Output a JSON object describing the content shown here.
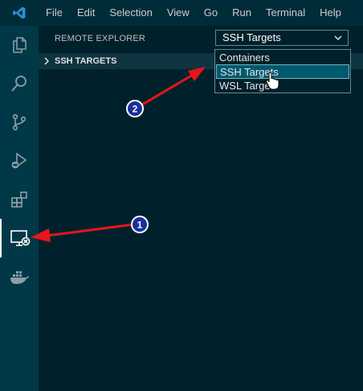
{
  "menu": [
    "File",
    "Edit",
    "Selection",
    "View",
    "Go",
    "Run",
    "Terminal",
    "Help"
  ],
  "activity_bar": {
    "icons": [
      "explorer-icon",
      "search-icon",
      "source-control-icon",
      "run-debug-icon",
      "extensions-icon",
      "remote-explorer-icon",
      "docker-icon"
    ],
    "active": "remote-explorer-icon"
  },
  "panel": {
    "title": "REMOTE EXPLORER",
    "select_value": "SSH Targets",
    "section_label": "SSH TARGETS"
  },
  "dropdown": {
    "options": [
      "Containers",
      "SSH Targets",
      "WSL Targets"
    ],
    "highlighted_option": "SSH Targets"
  },
  "annotations": {
    "badge_1": "1",
    "badge_2": "2",
    "arrow_color": "#e8141b",
    "badge_color": "#1b2f9c"
  },
  "colors": {
    "accent": "#007acc",
    "editor_bg": "#002b36",
    "activity_bar_bg": "#003847"
  }
}
